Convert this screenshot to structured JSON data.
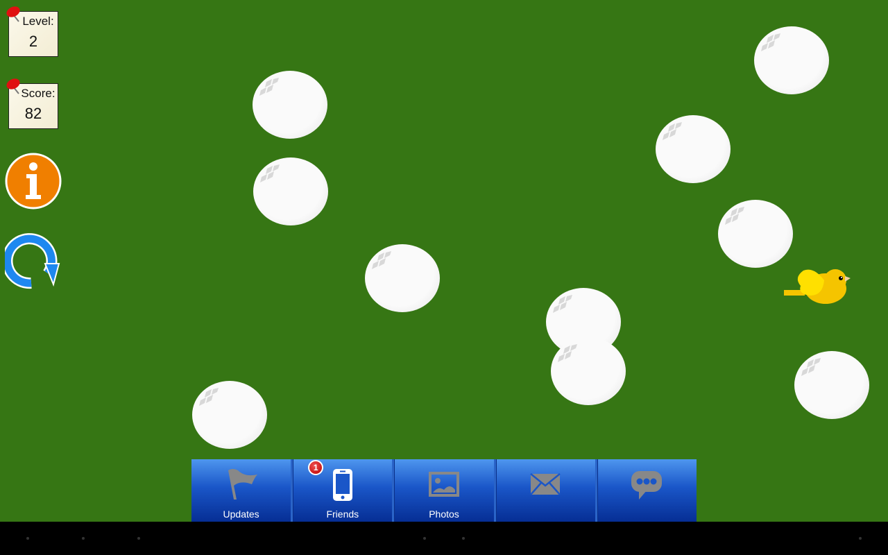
{
  "hud": {
    "level_label": "Level:",
    "level_value": "2",
    "score_label": "Score:",
    "score_value": "82"
  },
  "controls": {
    "info_icon": "info-icon",
    "restart_icon": "restart-icon"
  },
  "navbar": {
    "tabs": [
      {
        "label": "Updates",
        "icon": "flag-icon"
      },
      {
        "label": "Friends",
        "icon": "phone-icon",
        "badge": "1"
      },
      {
        "label": "Photos",
        "icon": "image-icon"
      },
      {
        "label": "",
        "icon": "mail-icon"
      },
      {
        "label": "",
        "icon": "chat-icon"
      }
    ]
  },
  "colors": {
    "background": "#367614",
    "info": "#f07f00",
    "restart": "#1e88f0",
    "bird": "#f5c400",
    "navbar": "#1a56c8"
  }
}
